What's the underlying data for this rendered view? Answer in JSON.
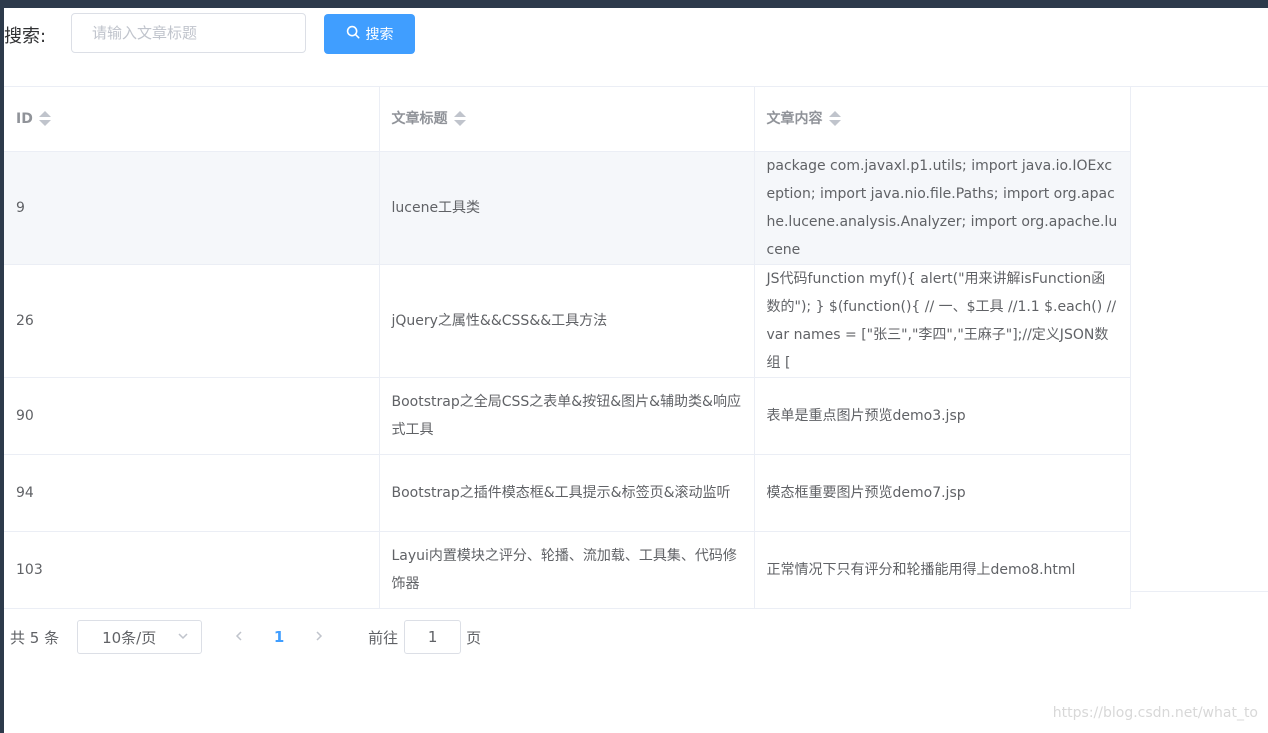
{
  "search": {
    "label": "搜索:",
    "placeholder": "请输入文章标题",
    "value": "",
    "button_label": "搜索",
    "button_icon": "search-icon",
    "accent_color": "#409eff"
  },
  "table": {
    "columns": [
      "ID",
      "文章标题",
      "文章内容"
    ],
    "rows": [
      {
        "id": "9",
        "title": "lucene工具类",
        "content": "package com.javaxl.p1.utils; import java.io.IOException; import java.nio.file.Paths; import org.apache.lucene.analysis.Analyzer; import org.apache.lucene"
      },
      {
        "id": "26",
        "title": "jQuery之属性&&CSS&&工具方法",
        "content": "JS代码function myf(){ alert(\"用来讲解isFunction函数的\"); } $(function(){ // 一、$工具 //1.1 $.each() // var names = [\"张三\",\"李四\",\"王麻子\"];//定义JSON数组 ["
      },
      {
        "id": "90",
        "title": "Bootstrap之全局CSS之表单&按钮&图片&辅助类&响应式工具",
        "content": "表单是重点图片预览demo3.jsp"
      },
      {
        "id": "94",
        "title": "Bootstrap之插件模态框&工具提示&标签页&滚动监听",
        "content": "模态框重要图片预览demo7.jsp"
      },
      {
        "id": "103",
        "title": "Layui内置模块之评分、轮播、流加载、工具集、代码修饰器",
        "content": "正常情况下只有评分和轮播能用得上demo8.html"
      }
    ]
  },
  "pagination": {
    "total_text": "共 5 条",
    "page_size": "10条/页",
    "current_page": "1",
    "jump_prefix": "前往",
    "jump_value": "1",
    "jump_suffix": "页"
  },
  "watermark": "https://blog.csdn.net/what_to"
}
